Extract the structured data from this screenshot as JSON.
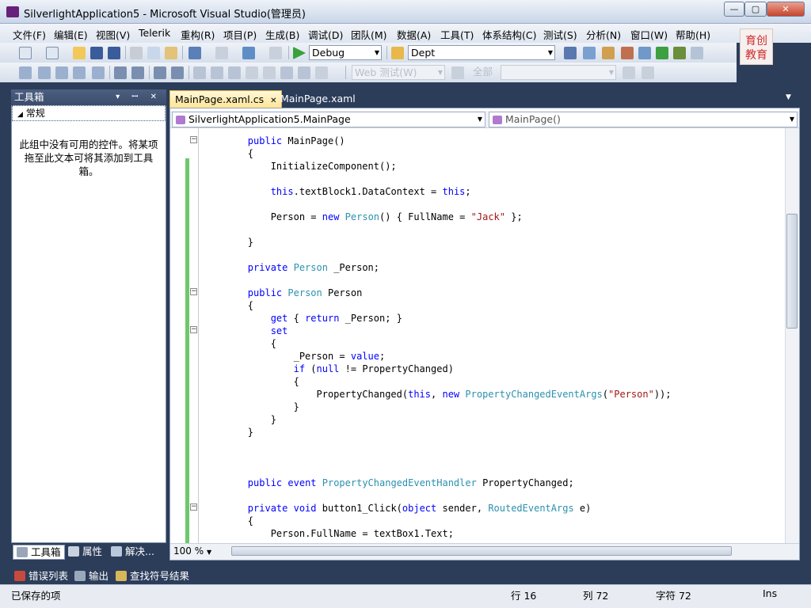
{
  "window": {
    "title": "SilverlightApplication5 - Microsoft Visual Studio(管理员)",
    "minimize": "—",
    "maximize": "▢",
    "close": "✕"
  },
  "menu": [
    "文件(F)",
    "编辑(E)",
    "视图(V)",
    "Telerik",
    "重构(R)",
    "项目(P)",
    "生成(B)",
    "调试(D)",
    "团队(M)",
    "数据(A)",
    "工具(T)",
    "体系结构(C)",
    "测试(S)",
    "分析(N)",
    "窗口(W)",
    "帮助(H)"
  ],
  "logo_text": "育创教育",
  "toolbar1": {
    "config": "Debug",
    "project": "Dept"
  },
  "toolbar2": {
    "target_combo": "Web 测试(W)",
    "filter_combo": "全部"
  },
  "toolbox": {
    "title": "工具箱",
    "header_buttons": "▾ ꟷ ✕",
    "group": "常规",
    "empty_text": "此组中没有可用的控件。将某项拖至此文本可将其添加到工具箱。",
    "tabs": [
      "工具箱",
      "属性",
      "解决..."
    ]
  },
  "editor": {
    "tabs": [
      {
        "label": "MainPage.xaml.cs",
        "close": "✕"
      },
      {
        "label": "MainPage.xaml"
      }
    ],
    "nav_left": "SilverlightApplication5.MainPage",
    "nav_right": "MainPage()",
    "zoom": "100 %",
    "code": [
      {
        "t": "        public MainPage()"
      },
      {
        "t": "        {"
      },
      {
        "t": "            InitializeComponent();"
      },
      {
        "t": ""
      },
      {
        "t": "            this.textBlock1.DataContext = this;"
      },
      {
        "t": ""
      },
      {
        "t": "            Person = new Person() { FullName = \"Jack\" };"
      },
      {
        "t": ""
      },
      {
        "t": "        }"
      },
      {
        "t": ""
      },
      {
        "t": "        private Person _Person;"
      },
      {
        "t": ""
      },
      {
        "t": "        public Person Person"
      },
      {
        "t": "        {"
      },
      {
        "t": "            get { return _Person; }"
      },
      {
        "t": "            set"
      },
      {
        "t": "            {"
      },
      {
        "t": "                _Person = value;"
      },
      {
        "t": "                if (null != PropertyChanged)"
      },
      {
        "t": "                {"
      },
      {
        "t": "                    PropertyChanged(this, new PropertyChangedEventArgs(\"Person\"));"
      },
      {
        "t": "                }"
      },
      {
        "t": "            }"
      },
      {
        "t": "        }"
      },
      {
        "t": ""
      },
      {
        "t": ""
      },
      {
        "t": ""
      },
      {
        "t": "        public event PropertyChangedEventHandler PropertyChanged;"
      },
      {
        "t": ""
      },
      {
        "t": "        private void button1_Click(object sender, RoutedEventArgs e)"
      },
      {
        "t": "        {"
      },
      {
        "t": "            Person.FullName = textBox1.Text;"
      }
    ]
  },
  "bottom_tabs": [
    "错误列表",
    "输出",
    "查找符号结果"
  ],
  "status": {
    "left": "已保存的项",
    "line": "行 16",
    "col": "列 72",
    "ch": "字符 72",
    "mode": "Ins"
  }
}
